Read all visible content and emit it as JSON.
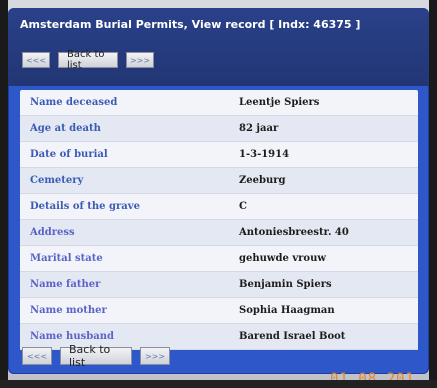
{
  "window": {
    "title": "Amsterdam Burial Permits, View record [ Indx: 46375 ]"
  },
  "nav": {
    "prev_label": "<<<",
    "back_label": "Back to list",
    "next_label": ">>>"
  },
  "colors": {
    "panel": "#2e57c9",
    "header": "#223674",
    "label_text": "#3b5bb5",
    "label_text_alt": "#5a63c8",
    "stamp": "#e8862a"
  },
  "record": [
    {
      "label": "Name deceased",
      "value": "Leentje Spiers"
    },
    {
      "label": "Age at death",
      "value": "82 jaar"
    },
    {
      "label": "Date of burial",
      "value": "1-3-1914"
    },
    {
      "label": "Cemetery",
      "value": "Zeeburg"
    },
    {
      "label": "Details of the grave",
      "value": "C"
    },
    {
      "label": "Address",
      "value": "Antoniesbreestr. 40"
    },
    {
      "label": "Marital state",
      "value": "gehuwde vrouw"
    },
    {
      "label": "Name father",
      "value": "Benjamin Spiers"
    },
    {
      "label": "Name mother",
      "value": "Sophia Haagman"
    },
    {
      "label": "Name husband",
      "value": "Barend Israel Boot"
    }
  ],
  "photo_timestamp": "01 08 201"
}
